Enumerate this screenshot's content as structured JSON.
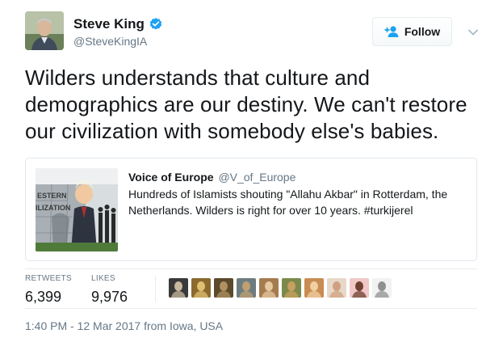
{
  "author": {
    "display_name": "Steve King",
    "handle": "@SteveKingIA",
    "verified": true
  },
  "follow_button": {
    "label": "Follow",
    "icon": "add-user-icon"
  },
  "menu_caret": {
    "icon": "chevron-down-icon"
  },
  "tweet": {
    "text": "Wilders understands that culture and demographics are our destiny. We can't restore our civilization with somebody else's babies."
  },
  "quoted_tweet": {
    "display_name": "Voice of Europe",
    "handle": "@V_of_Europe",
    "text": "Hundreds of Islamists shouting \"Allahu Akbar\" in Rotterdam, the Netherlands. Wilders is right for over 10 years. #turkijerel",
    "thumbnail_text_1": "ESTERN",
    "thumbnail_text_2": "ILIZATION"
  },
  "stats": {
    "retweets_label": "RETWEETS",
    "retweets_value": "6,399",
    "likes_label": "LIKES",
    "likes_value": "9,976"
  },
  "likers": [
    {
      "name": "liker-1",
      "bg": "#3a3a3a",
      "fg": "#c9b9a0"
    },
    {
      "name": "liker-2",
      "bg": "#8a6a2e",
      "fg": "#e0c070"
    },
    {
      "name": "liker-3",
      "bg": "#5c4a2c",
      "fg": "#b09060"
    },
    {
      "name": "liker-4",
      "bg": "#6d7c80",
      "fg": "#c0a070"
    },
    {
      "name": "liker-5",
      "bg": "#a57c50",
      "fg": "#e8c8a0"
    },
    {
      "name": "liker-6",
      "bg": "#7b8a4a",
      "fg": "#c9a060"
    },
    {
      "name": "liker-7",
      "bg": "#c88c54",
      "fg": "#f0d0a0"
    },
    {
      "name": "liker-8",
      "bg": "#e8d8c8",
      "fg": "#d0a080"
    },
    {
      "name": "liker-9",
      "bg": "#f0c8c8",
      "fg": "#704030"
    },
    {
      "name": "liker-10",
      "bg": "#f2f2f2",
      "fg": "#909090"
    }
  ],
  "timestamp": "1:40 PM - 12 Mar 2017 from Iowa, USA",
  "colors": {
    "text": "#14171a",
    "secondary": "#657786",
    "verified_blue": "#1da1f2",
    "border": "#e1e8ed"
  }
}
